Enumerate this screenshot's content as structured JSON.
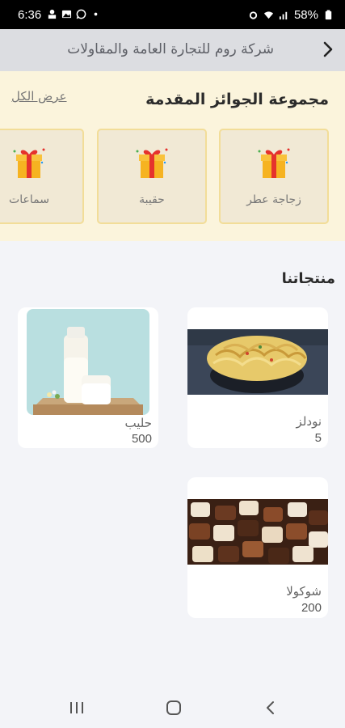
{
  "status_bar": {
    "time": "6:36",
    "battery": "58%",
    "icons": [
      "signal-icon",
      "gallery-icon",
      "whatsapp-icon",
      "dot-icon",
      "alarm-icon",
      "wifi-icon",
      "cell-signal-icon",
      "battery-icon"
    ]
  },
  "app_bar": {
    "title": "شركة روم للتجارة العامة والمقاولات",
    "back_icon": "chevron-right-icon"
  },
  "prizes": {
    "heading": "مجموعة الجوائز المقدمة",
    "view_all": "عرض الكل",
    "items": [
      {
        "label": "زجاجة عطر",
        "icon": "gift-icon"
      },
      {
        "label": "حقيبة",
        "icon": "gift-icon"
      },
      {
        "label": "سماعات",
        "icon": "gift-icon"
      }
    ]
  },
  "products": {
    "heading": "منتجاتنا",
    "items": [
      {
        "name": "نودلز",
        "price": "5"
      },
      {
        "name": "حليب",
        "price": "500"
      },
      {
        "name": "شوكولا",
        "price": "200"
      }
    ]
  },
  "nav_bar": {
    "buttons": [
      "recent-apps-icon",
      "home-icon",
      "back-icon"
    ]
  },
  "colors": {
    "prize_bg": "#fbf4dc",
    "prize_border": "#f2dd98",
    "app_bar": "#dcdde1",
    "page_bg": "#f3f4f8"
  }
}
